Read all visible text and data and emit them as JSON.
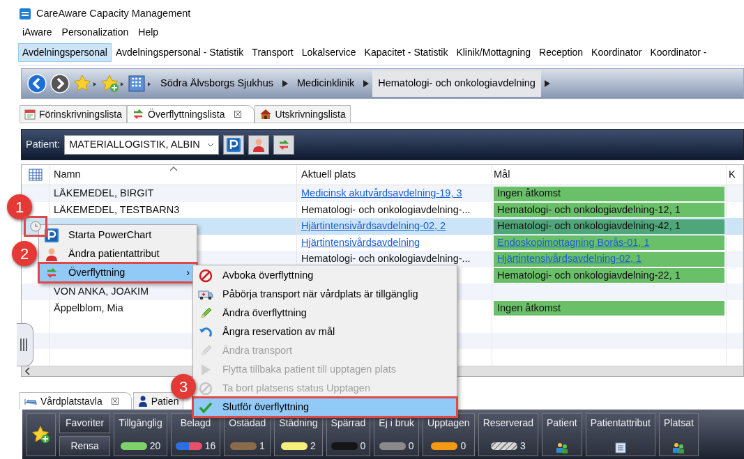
{
  "window": {
    "title": "CareAware Capacity Management"
  },
  "menu_bar": [
    "iAware",
    "Personalization",
    "Help"
  ],
  "perspectives": [
    {
      "label": "Avdelningspersonal",
      "selected": true
    },
    {
      "label": "Avdelningspersonal - Statistik",
      "selected": false
    },
    {
      "label": "Transport",
      "selected": false
    },
    {
      "label": "Lokalservice",
      "selected": false
    },
    {
      "label": "Kapacitet - Statistik",
      "selected": false
    },
    {
      "label": "Klinik/Mottagning",
      "selected": false
    },
    {
      "label": "Reception",
      "selected": false
    },
    {
      "label": "Koordinator",
      "selected": false
    },
    {
      "label": "Koordinator -",
      "selected": false
    }
  ],
  "breadcrumb": [
    {
      "label": "Södra Älvsborgs Sjukhus",
      "selected": false
    },
    {
      "label": "Medicinklinik",
      "selected": false
    },
    {
      "label": "Hematologi- och onkologiavdelning",
      "selected": true
    }
  ],
  "view_tabs": [
    {
      "label": "Förinskrivningslista",
      "selected": false,
      "kind": "calendar"
    },
    {
      "label": "Överflyttningslista",
      "selected": true,
      "kind": "transfer"
    },
    {
      "label": "Utskrivningslista",
      "selected": false,
      "kind": "house"
    }
  ],
  "patient_toolbar": {
    "label": "Patient:",
    "value": "MATERIALLOGISTIK, ALBIN"
  },
  "table": {
    "columns": [
      "Namn",
      "Aktuell plats",
      "Mål",
      "K"
    ],
    "rows": [
      {
        "selected": false,
        "marked": false,
        "name": "LÄKEMEDEL, BIRGIT",
        "current": {
          "text": "Medicinsk akutvårdsavdelning-19, 3",
          "link": true
        },
        "goal": {
          "text": "Ingen åtkomst",
          "link": false
        }
      },
      {
        "selected": false,
        "marked": false,
        "name": "LÄKEMEDEL, TESTBARN3",
        "current": {
          "text": "Hematologi- och onkologiavdelning-...",
          "link": false
        },
        "goal": {
          "text": "Hematologi- och onkologiavdelning-12, 1",
          "link": false
        }
      },
      {
        "selected": true,
        "marked": true,
        "current": {
          "text": "Hjärtintensivårdsavdelning-02, 2",
          "link": true
        },
        "goal": {
          "text": "Hematologi- och onkologiavdelning-42, 1",
          "link": false
        }
      },
      {
        "selected": false,
        "marked": false,
        "current": {
          "text": "Hjärtintensivårdsavdelning",
          "link": true
        },
        "goal": {
          "text": "Endoskopimottagning Borås-01, 1",
          "link": true
        }
      },
      {
        "selected": false,
        "marked": false,
        "current": {
          "text": "Hematologi- och onkologiavdelning-...",
          "link": false
        },
        "goal": {
          "text": "Hjärtintensivårdsavdelning-02, 1",
          "link": true
        }
      },
      {
        "selected": false,
        "marked": false,
        "goal": {
          "text": "Hematologi- och onkologiavdelning-22, 1",
          "link": false
        }
      },
      {
        "selected": false,
        "marked": false,
        "name": "VON ANKA, JOAKIM"
      },
      {
        "selected": false,
        "marked": false,
        "name": "Äppelblom, Mia",
        "goal": {
          "text": "Ingen åtkomst",
          "link": false
        }
      }
    ]
  },
  "context_menu": [
    {
      "label": "Starta PowerChart",
      "kind": "powerchart",
      "selected": false,
      "marked": false
    },
    {
      "label": "Ändra patientattribut",
      "kind": "person",
      "selected": false,
      "marked": false
    },
    {
      "label": "Överflyttning",
      "kind": "transfer",
      "selected": true,
      "marked": true,
      "submenu_arrow": "›"
    }
  ],
  "submenu": [
    {
      "label": "Avboka överflyttning",
      "kind": "cancel",
      "disabled": false,
      "selected": false,
      "marked": false
    },
    {
      "label": "Påbörja transport när vårdplats är tillgänglig",
      "kind": "vehicle",
      "disabled": false,
      "selected": false,
      "marked": false
    },
    {
      "label": "Ändra överflyttning",
      "kind": "pencil",
      "disabled": false,
      "selected": false,
      "marked": false
    },
    {
      "label": "Ångra reservation av mål",
      "kind": "undo",
      "disabled": false,
      "selected": false,
      "marked": false
    },
    {
      "label": "Ändra transport",
      "kind": "pencil",
      "disabled": true,
      "selected": false,
      "marked": false
    },
    {
      "label": "Flytta tillbaka patient till upptagen plats",
      "kind": "play",
      "disabled": true,
      "selected": false,
      "marked": false
    },
    {
      "label": "Ta bort platsens status Upptagen",
      "kind": "cancel",
      "disabled": true,
      "selected": false,
      "marked": false
    },
    {
      "label": "Slutför överflyttning",
      "kind": "check",
      "disabled": false,
      "selected": true,
      "marked": true
    }
  ],
  "annotations": [
    "1",
    "2",
    "3"
  ],
  "bottom_tabs": [
    {
      "label": "Vårdplatstavla",
      "selected": true
    },
    {
      "label": "Patien",
      "selected": false
    }
  ],
  "board_toolbar": {
    "favorites": "Favoriter",
    "clear": "Rensa",
    "statuses": [
      {
        "label": "Tillgänglig",
        "kind": "solid",
        "color": "#7ed26a",
        "count": "20"
      },
      {
        "label": "Belagd",
        "kind": "split",
        "color": "#e8506a",
        "count": "16"
      },
      {
        "label": "Ostädad",
        "kind": "solid",
        "color": "#8a6a4a",
        "count": "1"
      },
      {
        "label": "Städning",
        "kind": "solid",
        "color": "#f4ee7a",
        "count": "2"
      },
      {
        "label": "Spärrad",
        "kind": "solid",
        "color": "#151515",
        "count": "0"
      },
      {
        "label": "Ej i bruk",
        "kind": "solid",
        "color": "#8a8a8a",
        "count": "0"
      },
      {
        "label": "Upptagen",
        "kind": "solid",
        "color": "#f39a12",
        "count": "0"
      },
      {
        "label": "Reserverad",
        "kind": "striped",
        "color": "#d8d8d8",
        "count": "3"
      },
      {
        "label": "Patient",
        "kind": "people"
      },
      {
        "label": "Patientattribut",
        "kind": "list"
      },
      {
        "label": "Platsat",
        "kind": "people"
      }
    ]
  }
}
